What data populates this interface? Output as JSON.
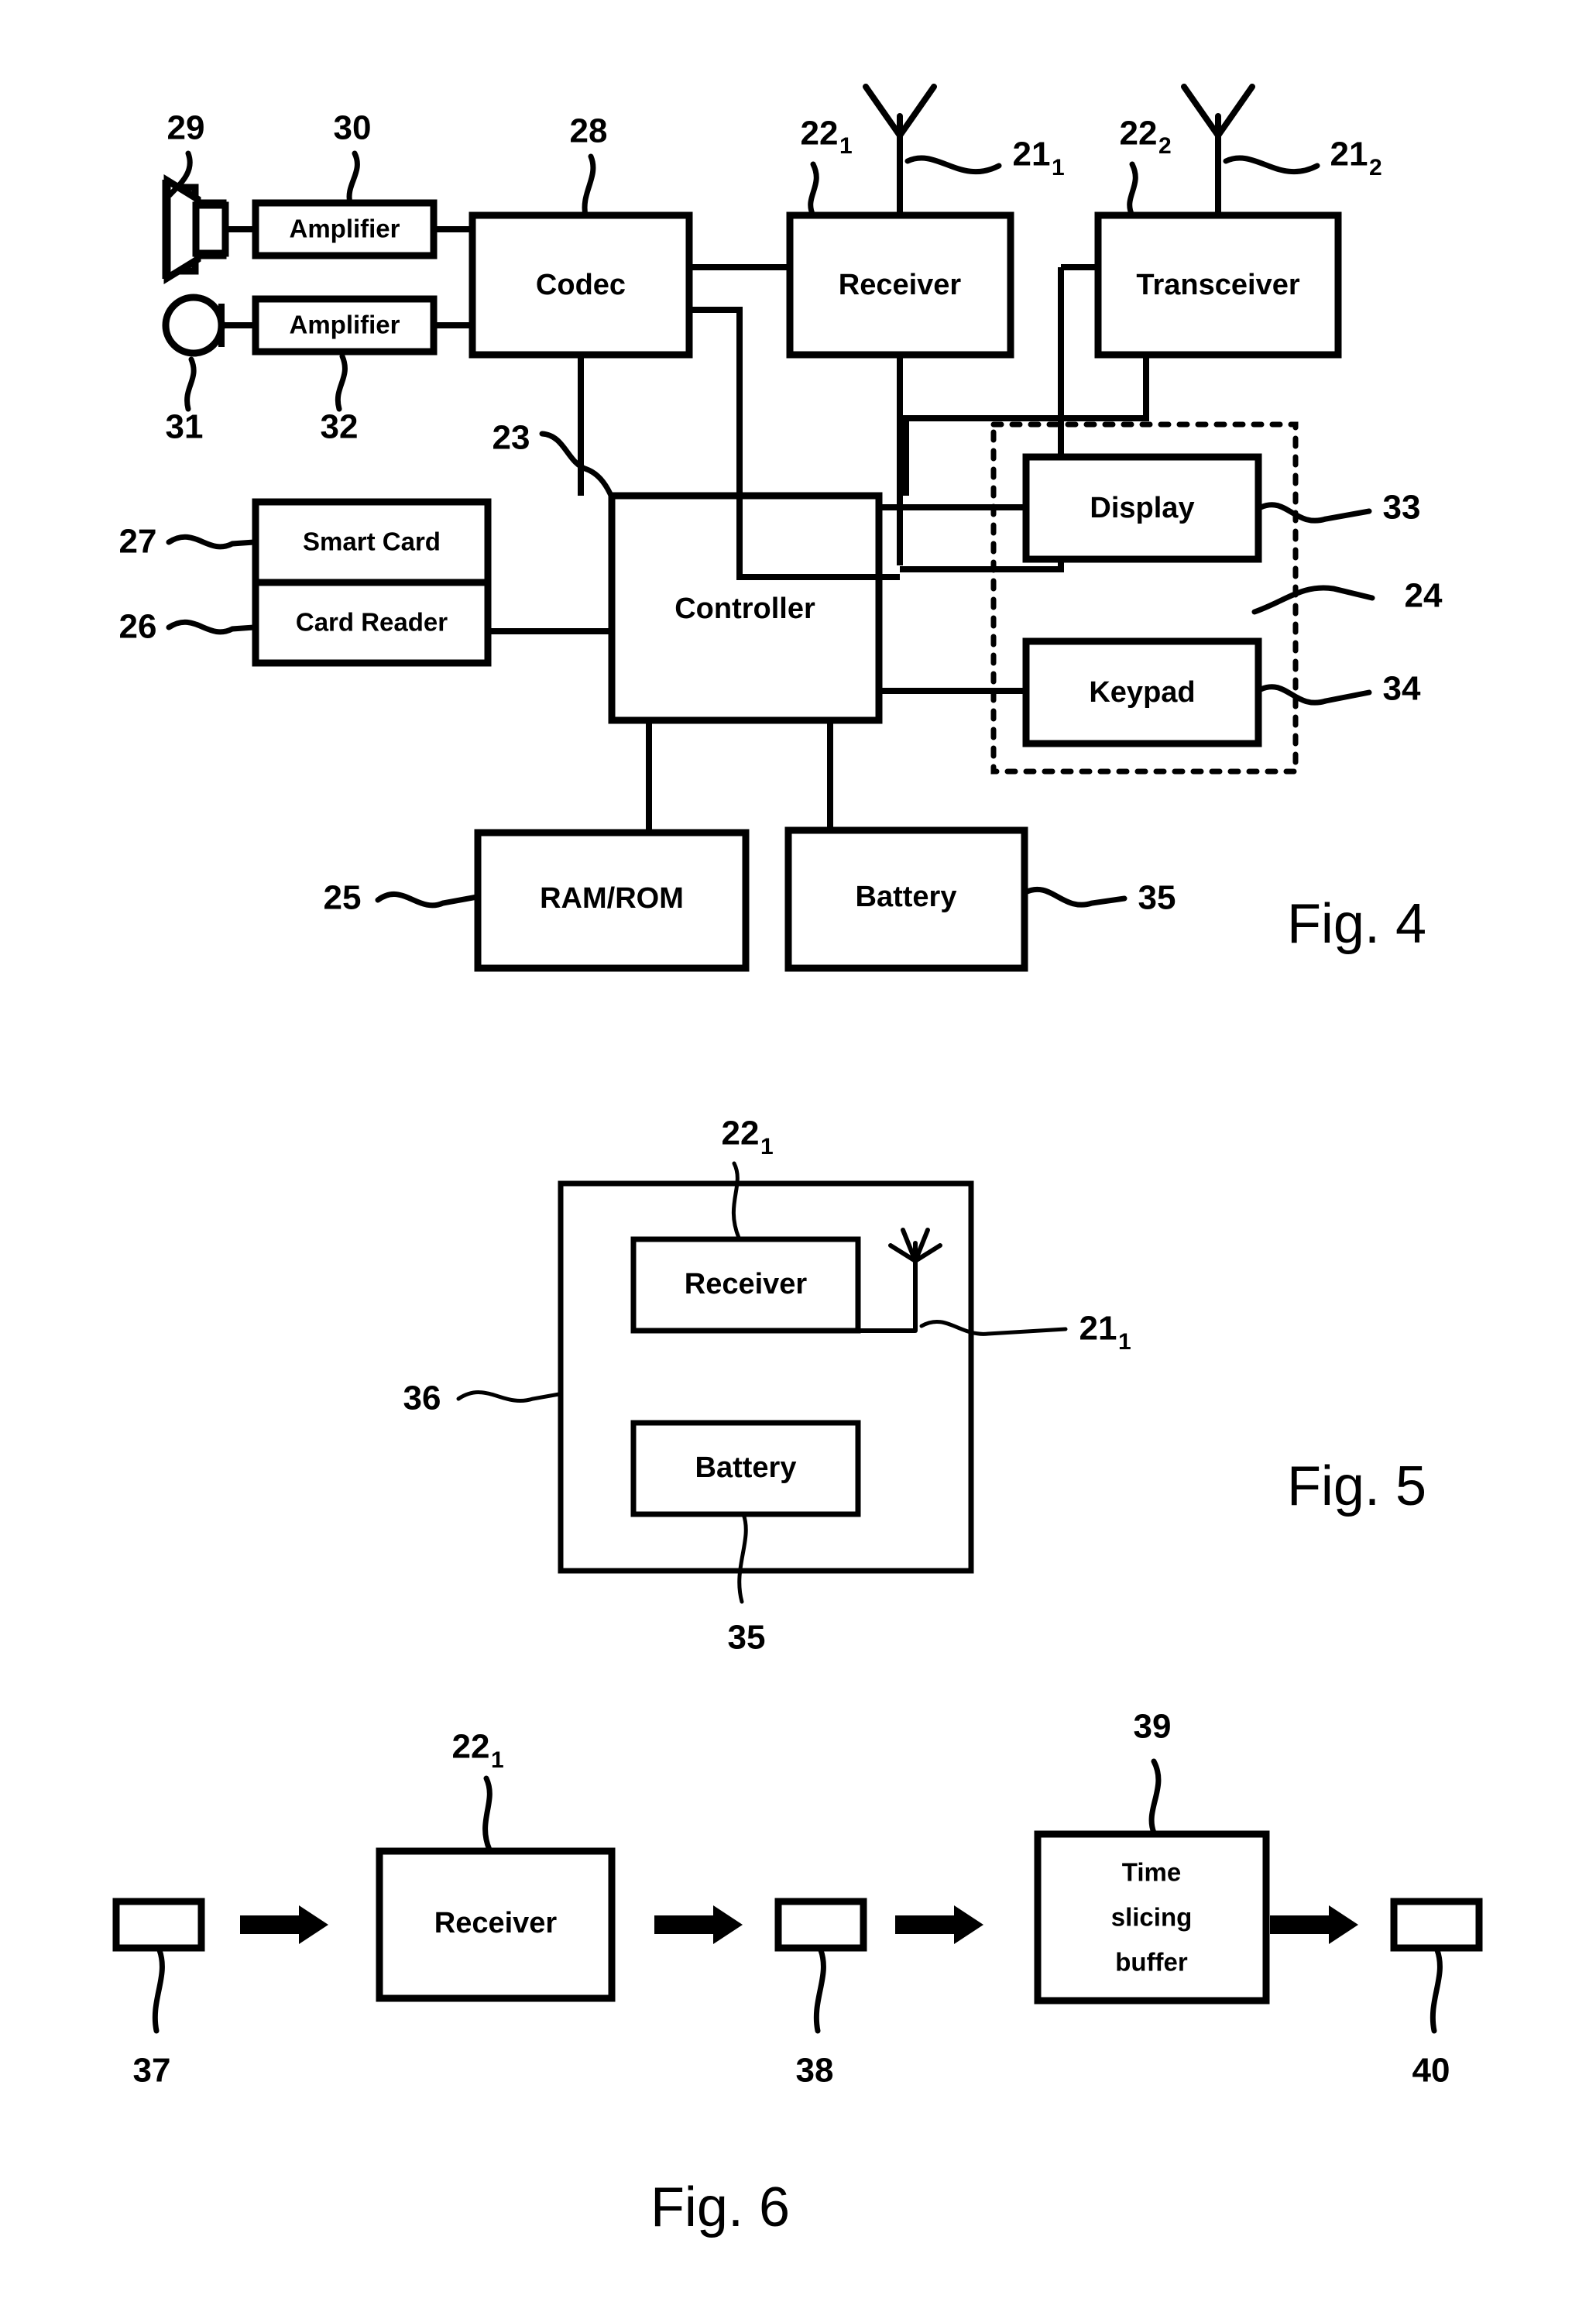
{
  "figures": [
    {
      "id": "fig4",
      "caption": "Fig. 4",
      "blocks": {
        "amplifier_top": "Amplifier",
        "amplifier_bottom": "Amplifier",
        "codec": "Codec",
        "receiver": "Receiver",
        "transceiver": "Transceiver",
        "controller": "Controller",
        "smart_card": "Smart Card",
        "card_reader": "Card Reader",
        "display": "Display",
        "keypad": "Keypad",
        "ram_rom": "RAM/ROM",
        "battery": "Battery"
      },
      "reference_numerals": {
        "speaker": "29",
        "amplifier_top": "30",
        "codec": "28",
        "receiver": "22",
        "receiver_sub": "1",
        "antenna_1": "21",
        "antenna_1_sub": "1",
        "transceiver": "22",
        "transceiver_sub": "2",
        "antenna_2": "21",
        "antenna_2_sub": "2",
        "microphone": "31",
        "amplifier_bottom": "32",
        "controller": "23",
        "smart_card": "27",
        "card_reader": "26",
        "display": "33",
        "user_interface": "24",
        "keypad": "34",
        "ram_rom": "25",
        "battery": "35"
      }
    },
    {
      "id": "fig5",
      "caption": "Fig. 5",
      "blocks": {
        "receiver": "Receiver",
        "battery": "Battery"
      },
      "reference_numerals": {
        "receiver": "22",
        "receiver_sub": "1",
        "antenna": "21",
        "antenna_sub": "1",
        "enclosure": "36",
        "battery": "35"
      }
    },
    {
      "id": "fig6",
      "caption": "Fig. 6",
      "blocks": {
        "receiver": "Receiver",
        "time_slicing_buffer_line1": "Time",
        "time_slicing_buffer_line2": "slicing",
        "time_slicing_buffer_line3": "buffer"
      },
      "reference_numerals": {
        "input_signal": "37",
        "receiver": "22",
        "receiver_sub": "1",
        "intermediate_signal": "38",
        "time_slicing_buffer": "39",
        "output_signal": "40"
      }
    }
  ],
  "colors": {
    "ink": "#000000",
    "paper": "#ffffff"
  }
}
